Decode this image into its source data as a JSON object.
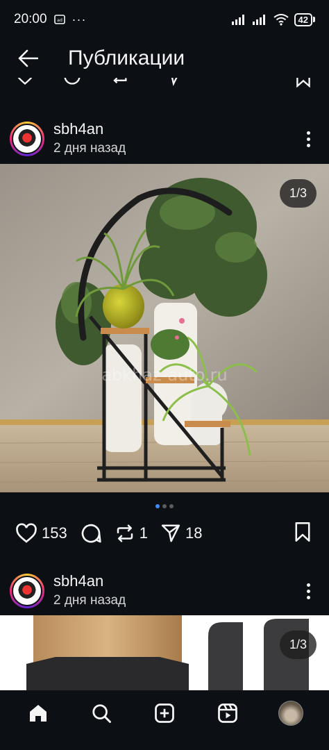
{
  "status_bar": {
    "time": "20:00",
    "more": "···",
    "battery": "42"
  },
  "header": {
    "title": "Публикации"
  },
  "posts": [
    {
      "username": "sbh4an",
      "time_ago": "2 дня назад",
      "image_counter": "1/3",
      "watermark": "abkhaz-auto.ru",
      "likes": "153",
      "reposts": "1",
      "shares": "18",
      "carousel_dots": 3,
      "carousel_active": 1
    },
    {
      "username": "sbh4an",
      "time_ago": "2 дня назад",
      "image_counter": "1/3"
    }
  ],
  "icons": {
    "back": "arrow-left-icon",
    "like": "heart-icon",
    "comment": "comment-icon",
    "repost": "repost-icon",
    "share": "send-icon",
    "save": "bookmark-icon",
    "nav": [
      "home-icon",
      "search-icon",
      "create-icon",
      "reels-icon",
      "profile-avatar"
    ]
  },
  "colors": {
    "background": "#0c1014",
    "text": "#f5f5f5",
    "active_dot": "#3e8ef7"
  }
}
